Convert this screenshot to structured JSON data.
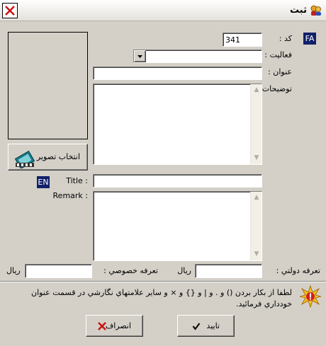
{
  "window": {
    "title": "ثبت"
  },
  "lang_badges": {
    "fa": "FA",
    "en": "EN"
  },
  "form": {
    "code_label": "کد :",
    "code_value": "341",
    "activity_label": "فعاليت :",
    "activity_value": "",
    "title_label": "عنوان :",
    "title_value": "",
    "description_label": "توضيحات :",
    "description_value": "",
    "en_title_label": "Title :",
    "en_title_value": "",
    "remark_label": "Remark :",
    "remark_value": "",
    "gov_tariff_label": "تعرفه دولتي :",
    "gov_tariff_value": "",
    "private_tariff_label": "تعرفه خصوصي :",
    "private_tariff_value": "",
    "currency": "ريال"
  },
  "photo": {
    "select_button_label": "انتخاب تصوير"
  },
  "notice": {
    "text": "لطفا از بکار بردن () و . و | و {} و × و ساير علامتهاي نگارشي در قسمت عنوان خودداري فرمائيد."
  },
  "buttons": {
    "confirm_label": "تاييد",
    "cancel_label": "انصراف"
  },
  "colors": {
    "window_bg": "#d4d0c8",
    "badge_bg": "#10206a",
    "close_red": "#cc1010"
  }
}
